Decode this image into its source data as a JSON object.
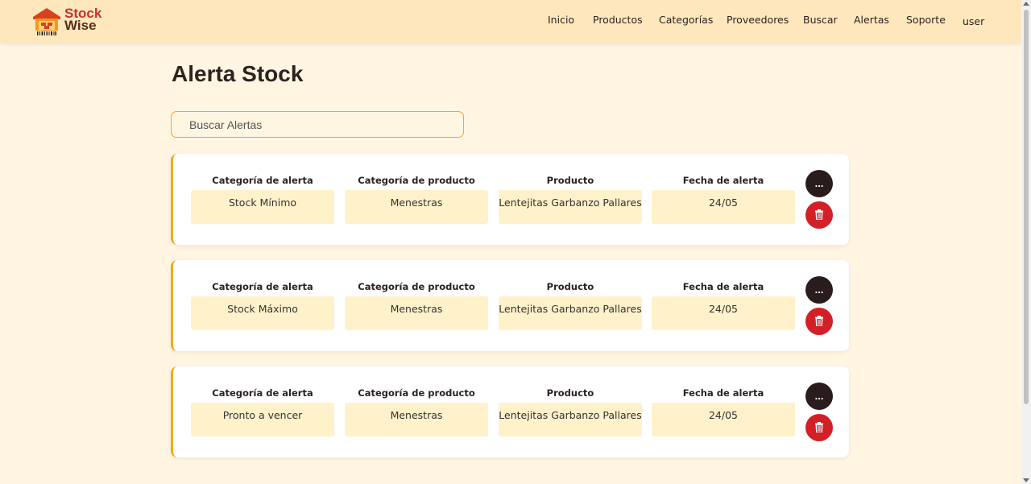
{
  "app": {
    "logo_line1": "Stock",
    "logo_line2": "Wise"
  },
  "nav": {
    "items": [
      {
        "label": "Inicio"
      },
      {
        "label": "Productos"
      },
      {
        "label": "Categorías"
      },
      {
        "label": "Proveedores"
      },
      {
        "label": "Buscar"
      },
      {
        "label": "Alertas"
      },
      {
        "label": "Soporte"
      }
    ],
    "user": "user"
  },
  "page": {
    "title": "Alerta Stock"
  },
  "search": {
    "placeholder": "Buscar Alertas"
  },
  "labels": {
    "alert_category": "Categoría de alerta",
    "product_category": "Categoría de producto",
    "product": "Producto",
    "alert_date": "Fecha de alerta"
  },
  "alerts": [
    {
      "alert_category": "Stock Mínimo",
      "product_category": "Menestras",
      "product": "Lentejitas Garbanzo Pallares",
      "date": "24/05",
      "more_label": "..."
    },
    {
      "alert_category": "Stock Máximo",
      "product_category": "Menestras",
      "product": "Lentejitas Garbanzo Pallares",
      "date": "24/05",
      "more_label": "..."
    },
    {
      "alert_category": "Pronto a vencer",
      "product_category": "Menestras",
      "product": "Lentejitas Garbanzo Pallares",
      "date": "24/05",
      "more_label": "..."
    }
  ],
  "colors": {
    "background": "#fff5e1",
    "navbar": "#ffe7bd",
    "accent": "#f2a91c",
    "field_bg": "#fff1c9",
    "more_button": "#2a1c1c",
    "delete_button": "#d32027"
  },
  "icons": {
    "logo": "warehouse-logo-icon",
    "delete": "trash-icon"
  }
}
